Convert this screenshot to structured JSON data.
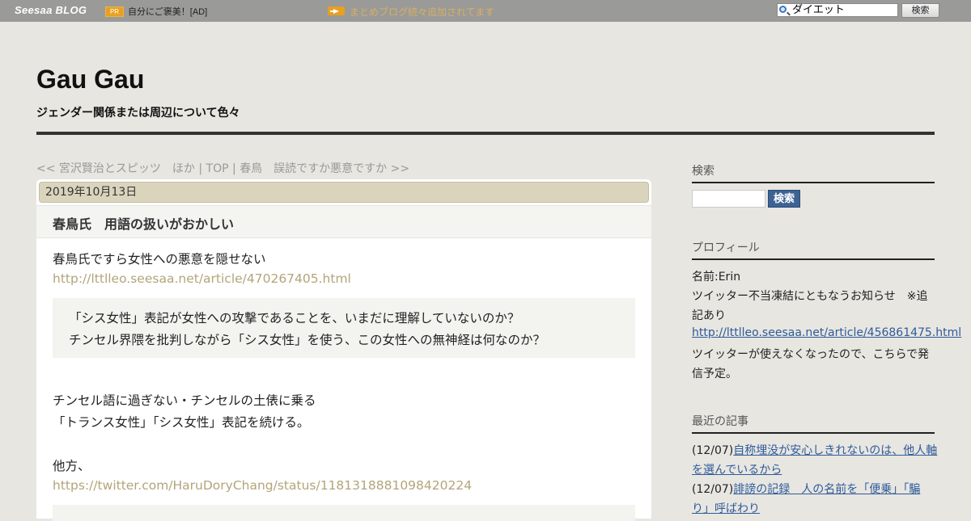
{
  "topbar": {
    "logo": "Seesaa BLOG",
    "pr_badge": "PR",
    "pr_text": "自分にご褒美！[AD]",
    "matome_link": "まとめブログ続々追加されてます",
    "search_value": "ダイエット",
    "search_button": "検索"
  },
  "header": {
    "title": "Gau Gau",
    "subtitle": "ジェンダー関係または周辺について色々"
  },
  "nav": {
    "prev": "<< 宮沢賢治とスピッツ　ほか",
    "sep1": " | ",
    "top": "TOP",
    "sep2": " | ",
    "next": "春鳥　誤読ですか悪意ですか >>"
  },
  "article": {
    "date": "2019年10月13日",
    "title": "春鳥氏　用語の扱いがおかしい",
    "para1": "春鳥氏ですら女性への悪意を隠せない",
    "link1": "http://lttlleo.seesaa.net/article/470267405.html",
    "quote1_line1": "「シス女性」表記が女性への攻撃であることを、いまだに理解していないのか？",
    "quote1_line2": "チンセル界隈を批判しながら「シス女性」を使う、この女性への無神経は何なのか？",
    "para2_line1": "チンセル語に過ぎない・チンセルの土俵に乗る",
    "para2_line2": "「トランス女性」「シス女性」表記を続ける。",
    "para3": "他方、",
    "link2": "https://twitter.com/HaruDoryChang/status/1181318881098420224"
  },
  "sidebar": {
    "search_heading": "検索",
    "search_button": "検索",
    "profile_heading": "プロフィール",
    "profile_name": "名前:Erin",
    "profile_line1": "ツイッター不当凍結にともなうお知らせ　※追",
    "profile_line2": "記あり",
    "profile_link": "http://lttlleo.seesaa.net/article/456861475.html",
    "profile_line3": "ツイッターが使えなくなったので、こちらで発",
    "profile_line4": "信予定。",
    "recent_heading": "最近の記事",
    "recent_items": [
      {
        "date": "(12/07)",
        "title_line1": "自称埋没が安心しきれないのは、他人軸",
        "title_line2": "を選んでいるから"
      },
      {
        "date": "(12/07)",
        "title_line1": "誹謗の記録　人の名前を「便乗」「騙",
        "title_line2": "り」呼ばわり"
      }
    ]
  }
}
